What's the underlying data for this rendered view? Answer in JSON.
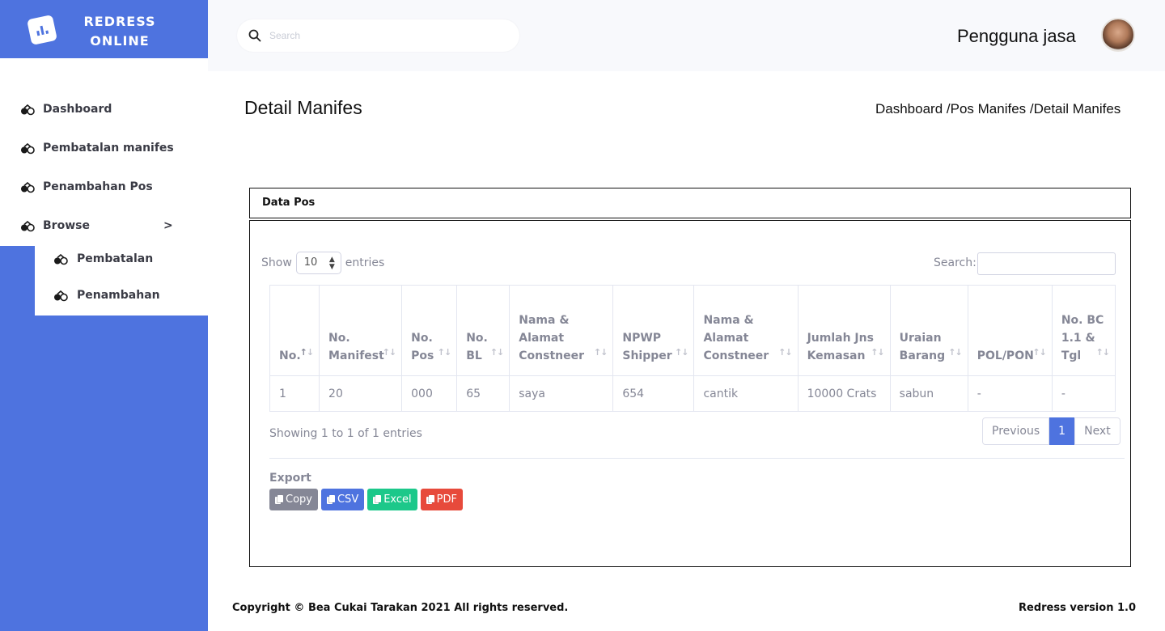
{
  "brand": {
    "line1": "REDRESS",
    "line2": "ONLINE",
    "icon": "chart-icon"
  },
  "sidebar": {
    "items": [
      {
        "label": "Dashboard",
        "icon": "pills-icon"
      },
      {
        "label": "Pembatalan manifes",
        "icon": "pills-icon"
      },
      {
        "label": "Penambahan Pos",
        "icon": "pills-icon"
      },
      {
        "label": "Browse",
        "icon": "pills-icon",
        "chevron": ">"
      }
    ],
    "submenu": [
      {
        "label": "Pembatalan",
        "icon": "pills-icon"
      },
      {
        "label": "Penambahan",
        "icon": "pills-icon"
      }
    ]
  },
  "topbar": {
    "search_placeholder": "Search",
    "user_name": "Pengguna jasa"
  },
  "page": {
    "title": "Detail Manifes",
    "breadcrumb": "Dashboard /Pos Manifes /Detail Manifes"
  },
  "card": {
    "header": "Data Pos"
  },
  "table": {
    "show_label": "Show",
    "entries_label": "entries",
    "page_length": "10",
    "search_label": "Search:",
    "columns": [
      "No.",
      "No. Manifest",
      "No. Pos",
      "No. BL",
      "Nama & Alamat Constneer",
      "NPWP Shipper",
      "Nama & Alamat Constneer",
      "Jumlah Jns Kemasan",
      "Uraian Barang",
      "POL/PON",
      "No. BC 1.1 & Tgl"
    ],
    "rows": [
      [
        "1",
        "20",
        "000",
        "65",
        "saya",
        "654",
        "cantik",
        "10000 Crats",
        "sabun",
        "-",
        "-"
      ]
    ],
    "info": "Showing 1 to 1 of 1 entries",
    "pager": {
      "previous": "Previous",
      "current": "1",
      "next": "Next"
    }
  },
  "export": {
    "label": "Export",
    "buttons": [
      "Copy",
      "CSV",
      "Excel",
      "PDF"
    ]
  },
  "footer": {
    "copyright": "Copyright © Bea Cukai Tarakan 2021 All rights reserved.",
    "version": "Redress version 1.0"
  },
  "colors": {
    "primary": "#4e73df",
    "copy": "#858796",
    "excel": "#1cc88a",
    "pdf": "#e74a3b"
  }
}
